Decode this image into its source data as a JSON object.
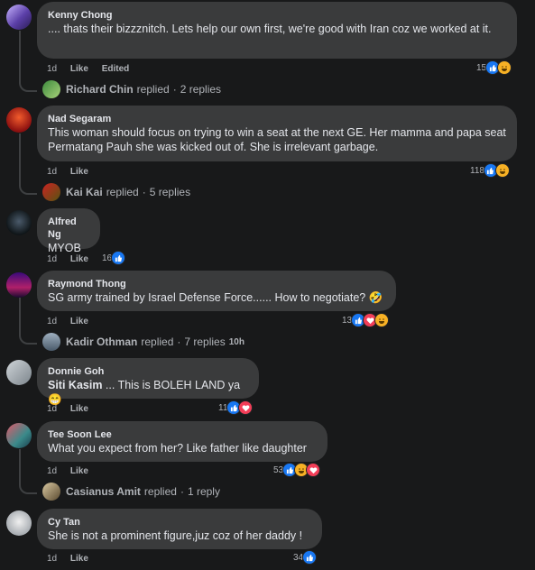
{
  "comments": [
    {
      "author": "Kenny Chong",
      "text": ".... thats their bizzznitch. Lets help our own first, we're good with Iran coz we worked at it.",
      "time": "1d",
      "like": "Like",
      "edited": "Edited",
      "reactions": {
        "count": "15",
        "icons": [
          "like-icon",
          "haha-icon"
        ]
      },
      "reply": {
        "name": "Richard Chin",
        "label": "replied",
        "count": "2 replies",
        "time": ""
      },
      "avatar_color": "#7a5cc2"
    },
    {
      "author": "Nad Segaram",
      "text": "This woman should focus on trying to win a seat at the next GE. Her mamma and papa seat Permatang Pauh she was kicked out of. She is irrelevant garbage.",
      "time": "1d",
      "like": "Like",
      "reactions": {
        "count": "118",
        "icons": [
          "like-icon",
          "haha-icon"
        ]
      },
      "reply": {
        "name": "Kai Kai",
        "label": "replied",
        "count": "5 replies",
        "time": ""
      },
      "avatar_color": "#b01c1c"
    },
    {
      "author": "Alfred Ng",
      "text": "MYOB",
      "time": "1d",
      "like": "Like",
      "reactions": {
        "count": "16",
        "icons": [
          "like-icon"
        ]
      },
      "avatar_color": "#2b3a48"
    },
    {
      "author": "Raymond Thong",
      "text": "SG army trained by Israel Defense Force...... How to negotiate? 🤣",
      "time": "1d",
      "like": "Like",
      "reactions": {
        "count": "13",
        "icons": [
          "like-icon",
          "love-icon",
          "haha-icon"
        ]
      },
      "reply": {
        "name": "Kadir Othman",
        "label": "replied",
        "count": "7 replies",
        "time": "10h"
      },
      "avatar_color": "#3a1a6b"
    },
    {
      "author": "Donnie Goh",
      "mention": "Siti Kasim",
      "text": " ... This is BOLEH LAND ya 😁",
      "time": "1d",
      "like": "Like",
      "reactions": {
        "count": "11",
        "icons": [
          "like-icon",
          "love-icon"
        ]
      },
      "avatar_color": "#8a939c"
    },
    {
      "author": "Tee Soon Lee",
      "text": "What you expect from her? Like father like daughter",
      "time": "1d",
      "like": "Like",
      "reactions": {
        "count": "53",
        "icons": [
          "like-icon",
          "haha-icon",
          "love-icon"
        ]
      },
      "reply": {
        "name": "Casianus Amit",
        "label": "replied",
        "count": "1 reply",
        "time": ""
      },
      "avatar_color": "#c03a4a"
    },
    {
      "author": "Cy Tan",
      "text": "She is not a prominent figure,juz coz of her daddy !",
      "time": "1d",
      "like": "Like",
      "reactions": {
        "count": "34",
        "icons": [
          "like-icon"
        ]
      },
      "avatar_color": "#d0d3d6"
    }
  ]
}
